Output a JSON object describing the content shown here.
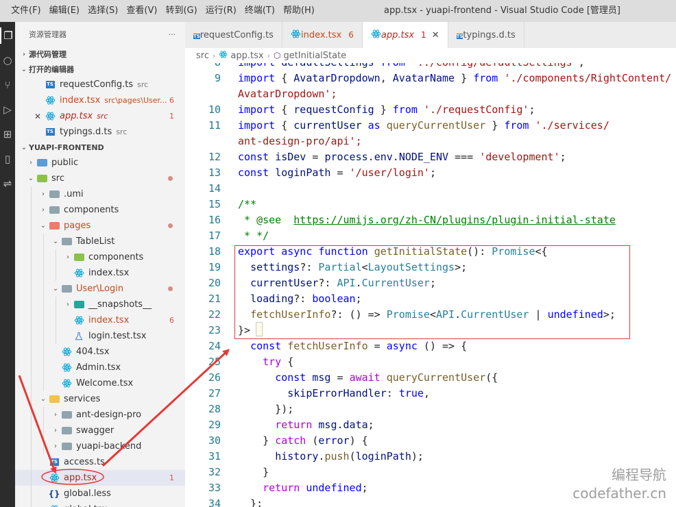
{
  "titlebar": {
    "menu": [
      "文件(F)",
      "编辑(E)",
      "选择(S)",
      "查看(V)",
      "转到(G)",
      "运行(R)",
      "终端(T)",
      "帮助(H)"
    ],
    "window_title": "app.tsx - yuapi-frontend - Visual Studio Code [管理员]"
  },
  "activitybar": {
    "icons": [
      "explorer-icon",
      "search-icon",
      "source-control-icon",
      "run-debug-icon",
      "extensions-icon",
      "bookmark-icon",
      "remote-icon"
    ]
  },
  "sidebar": {
    "title": "资源管理器",
    "more": "···",
    "source_control_section": "源代码管理",
    "open_editors_section": "打开的编辑器",
    "open_editors": [
      {
        "name": "requestConfig.ts",
        "desc": "src",
        "badge": "",
        "icon": "ts"
      },
      {
        "name": "index.tsx",
        "desc": "src\\pages\\User...",
        "badge": "6",
        "icon": "react"
      },
      {
        "name": "app.tsx",
        "desc": "src",
        "badge": "1",
        "icon": "react",
        "close": "✕"
      },
      {
        "name": "typings.d.ts",
        "desc": "src",
        "badge": "",
        "icon": "ts"
      }
    ],
    "project_section": "YUAPI-FRONTEND",
    "tree": [
      {
        "name": "public",
        "depth": 0,
        "twist": "›",
        "icon": "folder-blue"
      },
      {
        "name": "src",
        "depth": 0,
        "twist": "⌄",
        "icon": "folder-green",
        "dot": true
      },
      {
        "name": ".umi",
        "depth": 1,
        "twist": "›",
        "icon": "folder-grey"
      },
      {
        "name": "components",
        "depth": 1,
        "twist": "›",
        "icon": "folder-grey"
      },
      {
        "name": "pages",
        "depth": 1,
        "twist": "⌄",
        "icon": "folder-red",
        "dot": true
      },
      {
        "name": "TableList",
        "depth": 2,
        "twist": "⌄",
        "icon": "folder-grey"
      },
      {
        "name": "components",
        "depth": 3,
        "twist": "›",
        "icon": "folder-green"
      },
      {
        "name": "index.tsx",
        "depth": 3,
        "twist": "",
        "icon": "react"
      },
      {
        "name": "User\\Login",
        "depth": 2,
        "twist": "⌄",
        "icon": "folder-grey",
        "dot": true
      },
      {
        "name": "__snapshots__",
        "depth": 3,
        "twist": "›",
        "icon": "folder-teal"
      },
      {
        "name": "index.tsx",
        "depth": 3,
        "twist": "",
        "icon": "react",
        "badge": "6"
      },
      {
        "name": "login.test.tsx",
        "depth": 3,
        "twist": "",
        "icon": "flask"
      },
      {
        "name": "404.tsx",
        "depth": 2,
        "twist": "",
        "icon": "react"
      },
      {
        "name": "Admin.tsx",
        "depth": 2,
        "twist": "",
        "icon": "react"
      },
      {
        "name": "Welcome.tsx",
        "depth": 2,
        "twist": "",
        "icon": "react"
      },
      {
        "name": "services",
        "depth": 1,
        "twist": "⌄",
        "icon": "folder-yellow"
      },
      {
        "name": "ant-design-pro",
        "depth": 2,
        "twist": "›",
        "icon": "folder-grey"
      },
      {
        "name": "swagger",
        "depth": 2,
        "twist": "›",
        "icon": "folder-grey"
      },
      {
        "name": "yuapi-backend",
        "depth": 2,
        "twist": "›",
        "icon": "folder-grey"
      },
      {
        "name": "access.ts",
        "depth": 1,
        "twist": "",
        "icon": "ts"
      },
      {
        "name": "app.tsx",
        "depth": 1,
        "twist": "",
        "icon": "react",
        "badge": "1"
      },
      {
        "name": "global.less",
        "depth": 1,
        "twist": "",
        "icon": "braces"
      },
      {
        "name": "global.tsx",
        "depth": 1,
        "twist": "",
        "icon": "react"
      }
    ]
  },
  "tabs": [
    {
      "label": "requestConfig.ts",
      "icon": "ts",
      "active": false,
      "num": "",
      "close": ""
    },
    {
      "label": "index.tsx",
      "icon": "react",
      "active": false,
      "num": "6",
      "close": ""
    },
    {
      "label": "app.tsx",
      "icon": "react",
      "active": true,
      "num": "1",
      "close": "✕"
    },
    {
      "label": "typings.d.ts",
      "icon": "ts",
      "active": false,
      "num": "",
      "close": ""
    }
  ],
  "breadcrumb": [
    "src",
    "app.tsx",
    "getInitialState"
  ],
  "editor": {
    "lines": [
      {
        "n": "8",
        "t": "import defaultSettings from '../config/defaultSettings';"
      },
      {
        "n": "9",
        "t": "import { AvatarDropdown, AvatarName } from './components/RightContent/"
      },
      {
        "n": "",
        "t": "AvatarDropdown';"
      },
      {
        "n": "10",
        "t": "import { requestConfig } from './requestConfig';"
      },
      {
        "n": "11",
        "t": "import { currentUser as queryCurrentUser } from './services/"
      },
      {
        "n": "",
        "t": "ant-design-pro/api';"
      },
      {
        "n": "12",
        "t": "const isDev = process.env.NODE_ENV === 'development';"
      },
      {
        "n": "13",
        "t": "const loginPath = '/user/login';"
      },
      {
        "n": "14",
        "t": ""
      },
      {
        "n": "15",
        "t": "/**"
      },
      {
        "n": "16",
        "t": " * @see  https://umijs.org/zh-CN/plugins/plugin-initial-state"
      },
      {
        "n": "17",
        "t": " * */"
      },
      {
        "n": "18",
        "t": "export async function getInitialState(): Promise<{"
      },
      {
        "n": "19",
        "t": "  settings?: Partial<LayoutSettings>;"
      },
      {
        "n": "20",
        "t": "  currentUser?: API.CurrentUser;"
      },
      {
        "n": "21",
        "t": "  loading?: boolean;"
      },
      {
        "n": "22",
        "t": "  fetchUserInfo?: () => Promise<API.CurrentUser | undefined>;"
      },
      {
        "n": "23",
        "t": "}> {"
      },
      {
        "n": "24",
        "t": "  const fetchUserInfo = async () => {"
      },
      {
        "n": "25",
        "t": "    try {"
      },
      {
        "n": "26",
        "t": "      const msg = await queryCurrentUser({"
      },
      {
        "n": "27",
        "t": "        skipErrorHandler: true,"
      },
      {
        "n": "28",
        "t": "      });"
      },
      {
        "n": "29",
        "t": "      return msg.data;"
      },
      {
        "n": "30",
        "t": "    } catch (error) {"
      },
      {
        "n": "31",
        "t": "      history.push(loginPath);"
      },
      {
        "n": "32",
        "t": "    }"
      },
      {
        "n": "33",
        "t": "    return undefined;"
      },
      {
        "n": "34",
        "t": "  };"
      }
    ]
  },
  "watermark": {
    "line1": "编程导航",
    "line2": "codefather.cn"
  },
  "colors": {
    "highlight": "#d93b3b",
    "arrow": "#e53935",
    "activitybar": "#2c2c2c",
    "sidebar": "#f3f3f3"
  }
}
